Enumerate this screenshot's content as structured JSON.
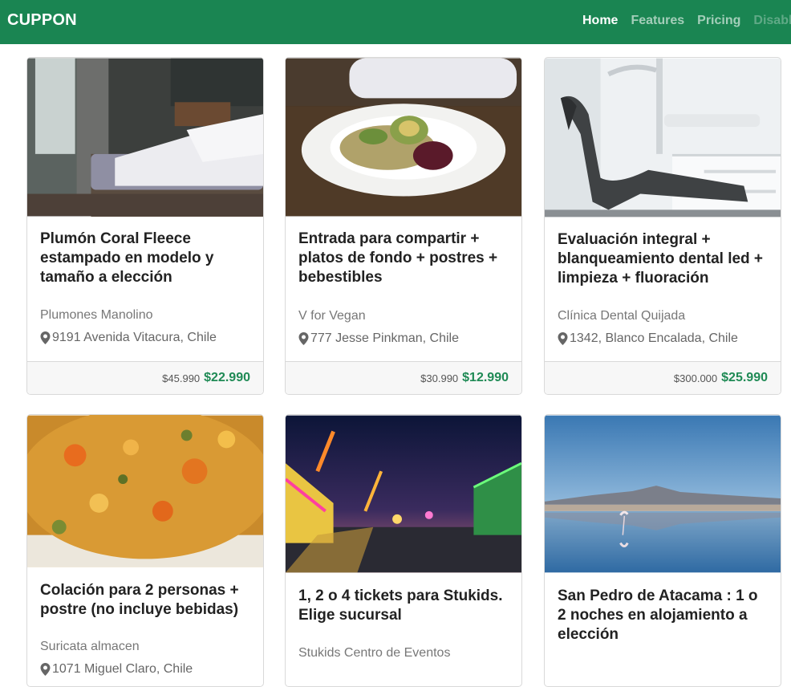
{
  "brand": "CUPPON",
  "nav": {
    "home": "Home",
    "features": "Features",
    "pricing": "Pricing",
    "disabled": "Disabled"
  },
  "cards": [
    {
      "title": "Plumón Coral Fleece estampado en modelo y tamaño a elección",
      "merchant": "Plumones Manolino",
      "address": "9191 Avenida Vitacura, Chile",
      "old_price": "$45.990",
      "new_price": "$22.990",
      "image": "bedroom-photo"
    },
    {
      "title": "Entrada para compartir + platos de fondo + postres + bebestibles",
      "merchant": "V for Vegan",
      "address": "777 Jesse Pinkman, Chile",
      "old_price": "$30.990",
      "new_price": "$12.990",
      "image": "vegan-dish-photo"
    },
    {
      "title": "Evaluación integral + blanqueamiento dental led + limpieza + fluoración",
      "merchant": "Clínica Dental Quijada",
      "address": "1342, Blanco Encalada, Chile",
      "old_price": "$300.000",
      "new_price": "$25.990",
      "image": "dental-chair-photo"
    },
    {
      "title": "Colación para 2 personas + postre (no incluye bebidas)",
      "merchant": "Suricata almacen",
      "address": "1071 Miguel Claro, Chile",
      "image": "food-plate-photo"
    },
    {
      "title": "1, 2 o 4 tickets para Stukids. Elige sucursal",
      "merchant": "Stukids Centro de Eventos",
      "image": "fair-night-photo"
    },
    {
      "title": "San Pedro de Atacama : 1 o 2 noches en alojamiento a elección",
      "image": "flamingo-lake-photo"
    }
  ]
}
